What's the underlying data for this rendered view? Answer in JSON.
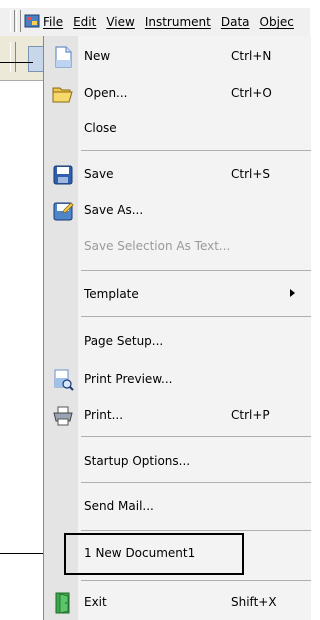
{
  "menubar": {
    "menus": [
      {
        "label": "File",
        "name": "menu-file"
      },
      {
        "label": "Edit",
        "name": "menu-edit"
      },
      {
        "label": "View",
        "name": "menu-view"
      },
      {
        "label": "Instrument",
        "name": "menu-instrument"
      },
      {
        "label": "Data",
        "name": "menu-data"
      },
      {
        "label": "Objec",
        "name": "menu-object"
      }
    ]
  },
  "file_menu": {
    "items": [
      {
        "label": "New",
        "shortcut": "Ctrl+N",
        "icon": "new-document-icon"
      },
      {
        "label": "Open...",
        "shortcut": "Ctrl+O",
        "icon": "open-folder-icon"
      },
      {
        "label": "Close",
        "shortcut": ""
      },
      {
        "label": "Save",
        "shortcut": "Ctrl+S",
        "icon": "save-disk-icon"
      },
      {
        "label": "Save As...",
        "shortcut": "",
        "icon": "save-as-icon"
      },
      {
        "label": "Save Selection As Text...",
        "shortcut": "",
        "disabled": true
      },
      {
        "label": "Template",
        "shortcut": "",
        "submenu": true
      },
      {
        "label": "Page Setup...",
        "shortcut": ""
      },
      {
        "label": "Print Preview...",
        "shortcut": "",
        "icon": "print-preview-icon"
      },
      {
        "label": "Print...",
        "shortcut": "Ctrl+P",
        "icon": "printer-icon"
      },
      {
        "label": "Startup Options...",
        "shortcut": ""
      },
      {
        "label": "Send Mail...",
        "shortcut": ""
      },
      {
        "label": "1 New Document1",
        "shortcut": ""
      },
      {
        "label": "Exit",
        "shortcut": "Shift+X",
        "icon": "exit-door-icon"
      }
    ]
  },
  "colors": {
    "menu_background": "#f3f3f3",
    "icon_gutter": "#e4e4e4",
    "disabled_text": "#9a9a9a",
    "accent_blue": "#3a7bd5",
    "exit_green": "#3aa84a"
  }
}
